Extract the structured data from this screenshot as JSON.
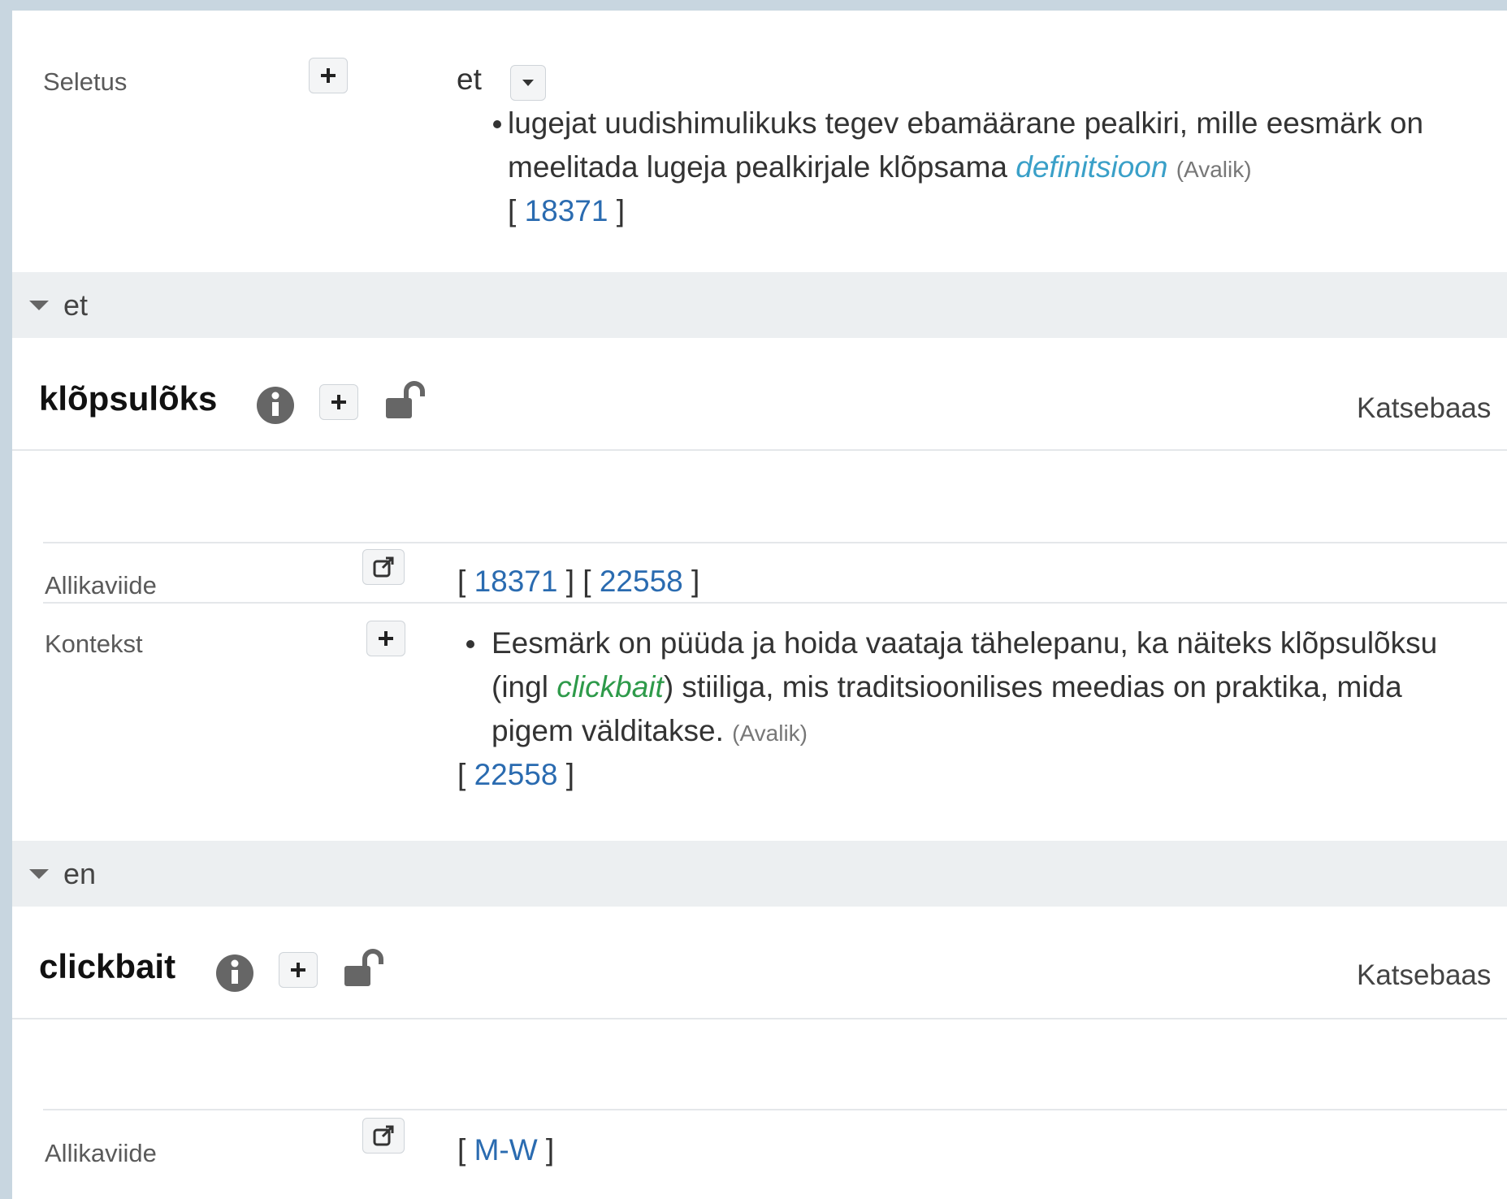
{
  "seletus": {
    "label": "Seletus",
    "lang": "et",
    "definition": "lugejat uudishimulikuks tegev ebamäärane pealkiri, mille eesmärk on",
    "definition_line2": "meelitada lugeja pealkirjale klõpsama",
    "type_label": "definitsioon",
    "visibility": "(Avalik)",
    "ref_open": "[",
    "ref": "18371",
    "ref_close": "]"
  },
  "sections": [
    {
      "lang": "et",
      "term": "klõpsulõks",
      "dataset": "Katsebaas",
      "allikaviide_label": "Allikaviide",
      "refs": [
        "18371",
        "22558"
      ],
      "kontekst_label": "Kontekst",
      "context_line1": "Eesmärk on püüda ja hoida vaataja tähelepanu, ka näiteks klõpsulõksu",
      "context_line2_pre": "(ingl ",
      "context_line2_em": "clickbait",
      "context_line2_post": ") stiiliga, mis traditsioonilises meedias on praktika, mida",
      "context_line3": "pigem välditakse.",
      "context_visibility": "(Avalik)",
      "context_ref": "22558"
    },
    {
      "lang": "en",
      "term": "clickbait",
      "dataset": "Katsebaas",
      "allikaviide_label": "Allikaviide",
      "refs": [
        "M-W"
      ]
    }
  ],
  "colors": {
    "link": "#2a6bb0",
    "definition_type": "#3aa0c8",
    "english_term": "#2e9a4a",
    "lang_bar": "#eceff1"
  }
}
